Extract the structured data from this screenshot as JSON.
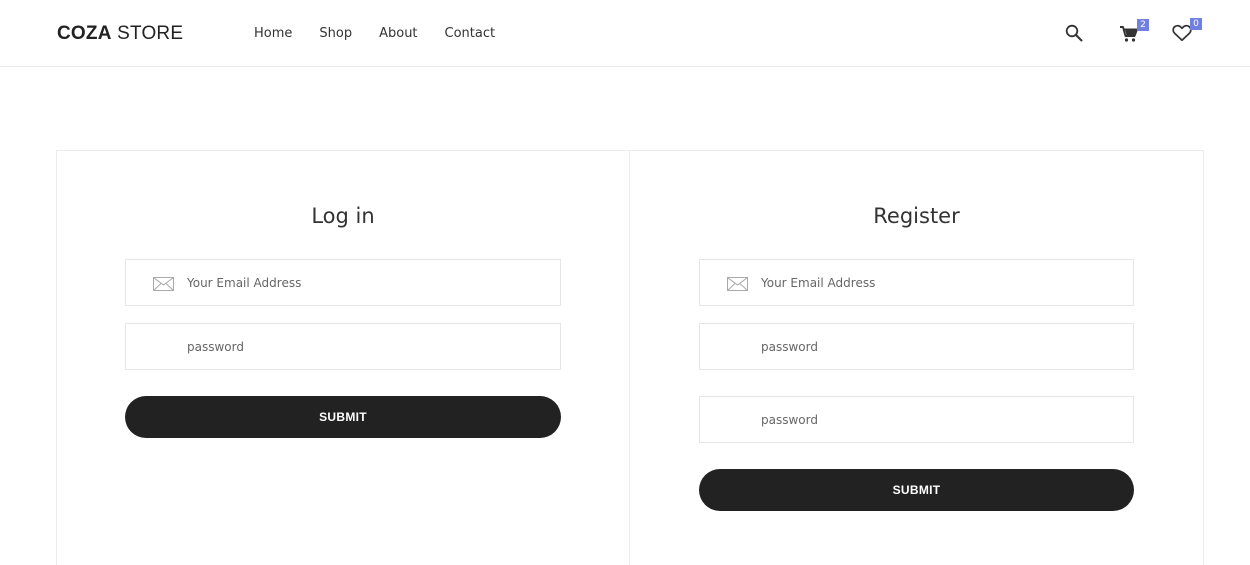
{
  "header": {
    "logo_bold": "COZA",
    "logo_light": " STORE",
    "nav": [
      {
        "label": "Home"
      },
      {
        "label": "Shop"
      },
      {
        "label": "About"
      },
      {
        "label": "Contact"
      }
    ],
    "cart_count": "2",
    "wishlist_count": "0"
  },
  "login": {
    "title": "Log in",
    "email_placeholder": "Your Email Address",
    "password_placeholder": "password",
    "submit_label": "SUBMIT"
  },
  "register": {
    "title": "Register",
    "email_placeholder": "Your Email Address",
    "password_placeholder": "password",
    "confirm_placeholder": "password",
    "submit_label": "SUBMIT"
  },
  "colors": {
    "accent": "#717fe0",
    "button": "#222222"
  }
}
